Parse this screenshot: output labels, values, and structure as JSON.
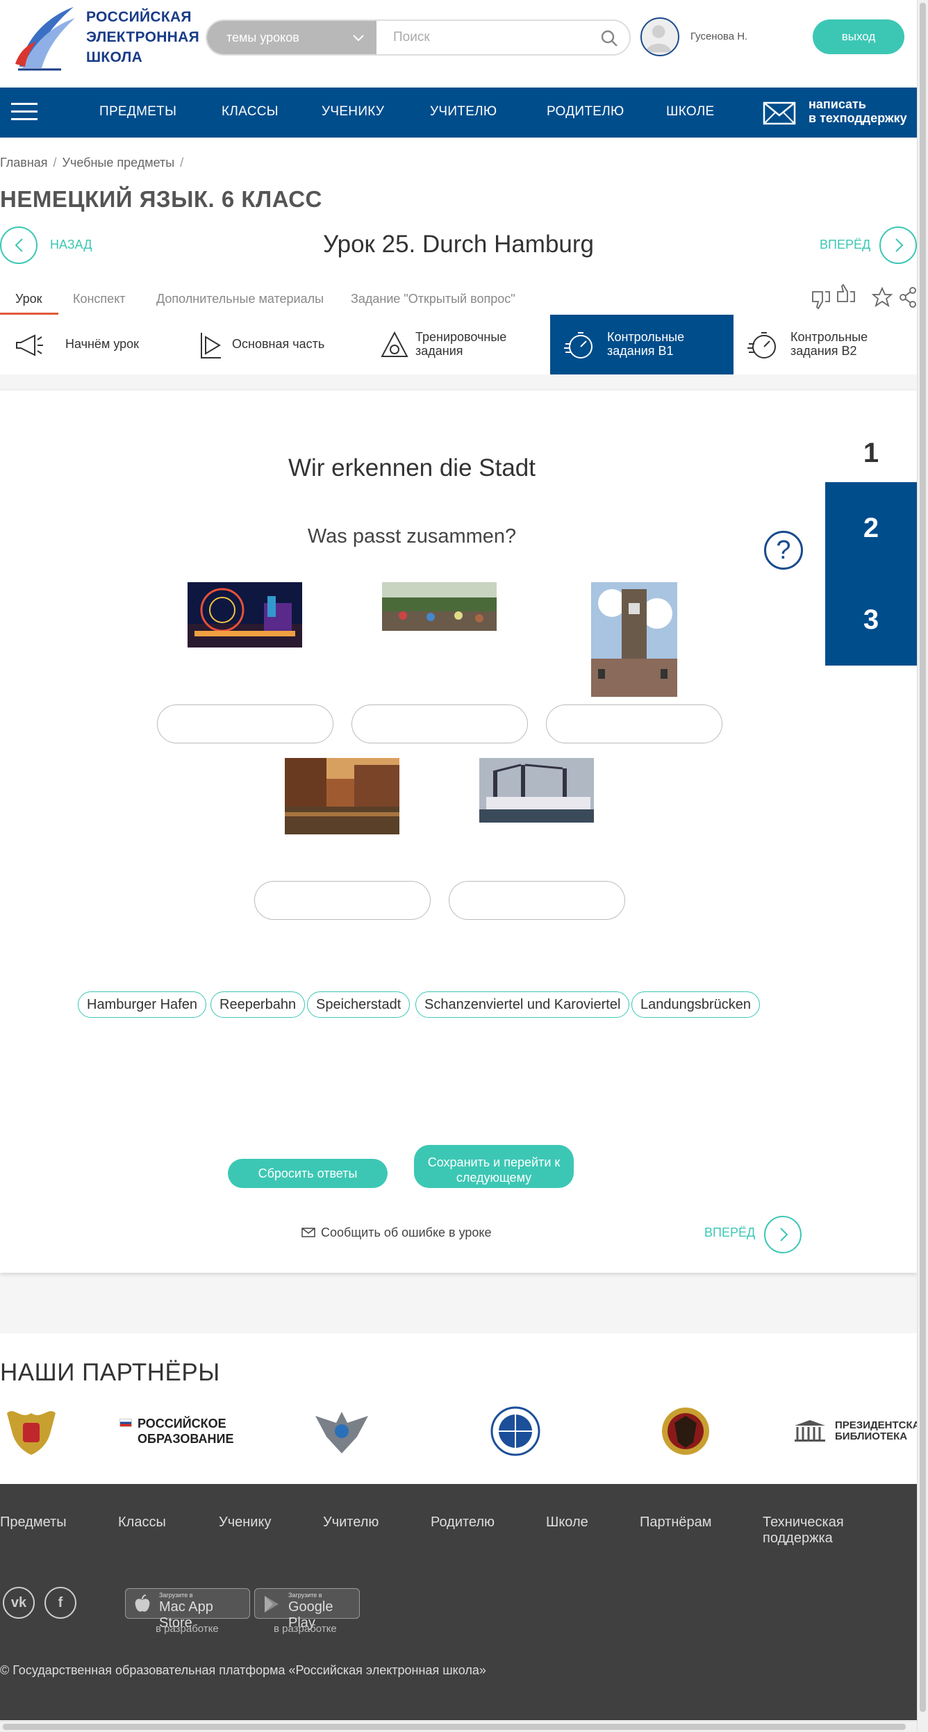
{
  "header": {
    "logo_lines": [
      "РОССИЙСКАЯ",
      "ЭЛЕКТРОННАЯ",
      "ШКОЛА"
    ],
    "topic_select": "темы уроков",
    "search_placeholder": "Поиск",
    "user_name": "Гусенова Н.",
    "logout": "выход"
  },
  "nav": {
    "items": [
      "ПРЕДМЕТЫ",
      "КЛАССЫ",
      "УЧЕНИКУ",
      "УЧИТЕЛЮ",
      "РОДИТЕЛЮ",
      "ШКОЛЕ"
    ],
    "support_line1": "написать",
    "support_line2": "в техподдержку"
  },
  "breadcrumb": [
    "Главная",
    "Учебные предметы"
  ],
  "course_title": "НЕМЕЦКИЙ ЯЗЫК. 6 КЛАСС",
  "lesson": {
    "back": "НАЗАД",
    "title": "Урок 25. Durch Hamburg",
    "forward": "ВПЕРЁД"
  },
  "tabs": [
    "Урок",
    "Конспект",
    "Дополнительные материалы",
    "Задание \"Открытый вопрос\""
  ],
  "steps": [
    {
      "line1": "Начнём урок",
      "line2": ""
    },
    {
      "line1": "Основная часть",
      "line2": ""
    },
    {
      "line1": "Тренировочные",
      "line2": "задания"
    },
    {
      "line1": "Контрольные",
      "line2": "задания B1"
    },
    {
      "line1": "Контрольные",
      "line2": "задания B2"
    }
  ],
  "task": {
    "title": "Wir erkennen die Stadt",
    "subtitle": "Was passt zusammen?",
    "help": "?",
    "pages": [
      "1",
      "2",
      "3"
    ],
    "answers": [
      "Hamburger Hafen",
      "Reeperbahn",
      "Speicherstadt",
      "Schanzenviertel und Karoviertel",
      "Landungsbrücken"
    ],
    "reset": "Сбросить ответы",
    "save_line1": "Сохранить и перейти к",
    "save_line2": "следующему",
    "report": "Сообщить об ошибке в уроке",
    "forward": "ВПЕРЁД"
  },
  "partners": {
    "title": "НАШИ ПАРТНЁРЫ",
    "ros_obr_line1": "РОССИЙСКОЕ",
    "ros_obr_line2": "ОБРАЗОВАНИЕ",
    "lib_line1": "ПРЕЗИДЕНТСКАЯ",
    "lib_line2": "БИБЛИОТЕКА"
  },
  "footer": {
    "links": [
      "Предметы",
      "Классы",
      "Ученику",
      "Учителю",
      "Родителю",
      "Школе",
      "Партнёрам",
      "Техническая поддержка"
    ],
    "vk": "vk",
    "fb": "f",
    "appstore_small": "Загрузите в",
    "appstore_big": "Mac App Store",
    "gplay_small": "Загрузите в",
    "gplay_big": "Google Play",
    "in_dev": "в разработке",
    "copyright": "© Государственная образовательная платформа «Российская электронная школа»"
  },
  "colors": {
    "brand_blue": "#004d8c",
    "accent_teal": "#3cc7b4",
    "tab_accent": "#e05a3a"
  }
}
